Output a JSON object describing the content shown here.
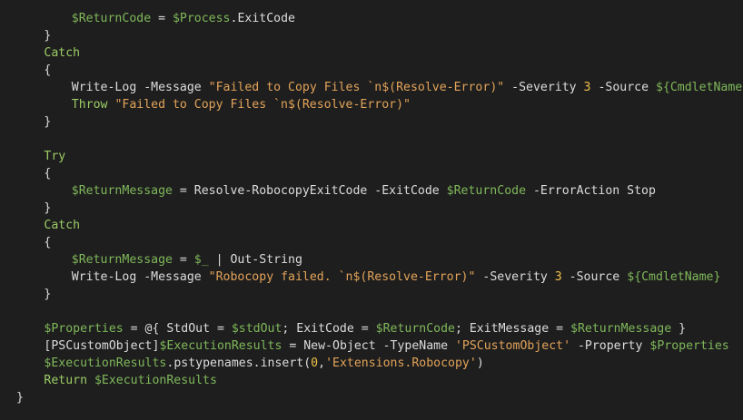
{
  "colors": {
    "background": "#1e1e1e",
    "plain": "#dcdcdc",
    "variable": "#7fb85a",
    "keyword": "#9ccc65",
    "string": "#e2a35a",
    "number": "#f0c04a"
  },
  "lines": [
    {
      "indent": 8,
      "tokens": [
        {
          "c": "var",
          "t": "$ReturnCode"
        },
        {
          "c": "plain",
          "t": " = "
        },
        {
          "c": "var",
          "t": "$Process"
        },
        {
          "c": "plain",
          "t": ".ExitCode"
        }
      ]
    },
    {
      "indent": 4,
      "tokens": [
        {
          "c": "plain",
          "t": "}"
        }
      ]
    },
    {
      "indent": 4,
      "tokens": [
        {
          "c": "kw",
          "t": "Catch"
        }
      ]
    },
    {
      "indent": 4,
      "tokens": [
        {
          "c": "plain",
          "t": "{"
        }
      ]
    },
    {
      "indent": 8,
      "tokens": [
        {
          "c": "plain",
          "t": "Write-Log "
        },
        {
          "c": "param",
          "t": "-Message "
        },
        {
          "c": "str",
          "t": "\"Failed to Copy Files `n$(Resolve-Error)\""
        },
        {
          "c": "param",
          "t": " -Severity "
        },
        {
          "c": "num",
          "t": "3"
        },
        {
          "c": "param",
          "t": " -Source "
        },
        {
          "c": "var",
          "t": "${CmdletName}"
        }
      ]
    },
    {
      "indent": 8,
      "tokens": [
        {
          "c": "kw",
          "t": "Throw "
        },
        {
          "c": "str",
          "t": "\"Failed to Copy Files `n$(Resolve-Error)\""
        }
      ]
    },
    {
      "indent": 4,
      "tokens": [
        {
          "c": "plain",
          "t": "}"
        }
      ]
    },
    {
      "indent": 0,
      "tokens": []
    },
    {
      "indent": 4,
      "tokens": [
        {
          "c": "kw",
          "t": "Try"
        }
      ]
    },
    {
      "indent": 4,
      "tokens": [
        {
          "c": "plain",
          "t": "{"
        }
      ]
    },
    {
      "indent": 8,
      "tokens": [
        {
          "c": "var",
          "t": "$ReturnMessage"
        },
        {
          "c": "plain",
          "t": " = Resolve-RobocopyExitCode "
        },
        {
          "c": "param",
          "t": "-ExitCode "
        },
        {
          "c": "var",
          "t": "$ReturnCode"
        },
        {
          "c": "param",
          "t": " -ErrorAction Stop"
        }
      ]
    },
    {
      "indent": 4,
      "tokens": [
        {
          "c": "plain",
          "t": "}"
        }
      ]
    },
    {
      "indent": 4,
      "tokens": [
        {
          "c": "kw",
          "t": "Catch"
        }
      ]
    },
    {
      "indent": 4,
      "tokens": [
        {
          "c": "plain",
          "t": "{"
        }
      ]
    },
    {
      "indent": 8,
      "tokens": [
        {
          "c": "var",
          "t": "$ReturnMessage"
        },
        {
          "c": "plain",
          "t": " = "
        },
        {
          "c": "var",
          "t": "$_"
        },
        {
          "c": "plain",
          "t": " | Out-String"
        }
      ]
    },
    {
      "indent": 8,
      "tokens": [
        {
          "c": "plain",
          "t": "Write-Log "
        },
        {
          "c": "param",
          "t": "-Message "
        },
        {
          "c": "str",
          "t": "\"Robocopy failed. `n$(Resolve-Error)\""
        },
        {
          "c": "param",
          "t": " -Severity "
        },
        {
          "c": "num",
          "t": "3"
        },
        {
          "c": "param",
          "t": " -Source "
        },
        {
          "c": "var",
          "t": "${CmdletName}"
        }
      ]
    },
    {
      "indent": 4,
      "tokens": [
        {
          "c": "plain",
          "t": "}"
        }
      ]
    },
    {
      "indent": 0,
      "tokens": []
    },
    {
      "indent": 4,
      "tokens": [
        {
          "c": "var",
          "t": "$Properties"
        },
        {
          "c": "plain",
          "t": " = @{ StdOut = "
        },
        {
          "c": "var",
          "t": "$stdOut"
        },
        {
          "c": "plain",
          "t": "; ExitCode = "
        },
        {
          "c": "var",
          "t": "$ReturnCode"
        },
        {
          "c": "plain",
          "t": "; ExitMessage = "
        },
        {
          "c": "var",
          "t": "$ReturnMessage"
        },
        {
          "c": "plain",
          "t": " }"
        }
      ]
    },
    {
      "indent": 4,
      "tokens": [
        {
          "c": "type",
          "t": "[PSCustomObject]"
        },
        {
          "c": "var",
          "t": "$ExecutionResults"
        },
        {
          "c": "plain",
          "t": " = New-Object "
        },
        {
          "c": "param",
          "t": "-TypeName "
        },
        {
          "c": "str",
          "t": "'PSCustomObject'"
        },
        {
          "c": "param",
          "t": " -Property "
        },
        {
          "c": "var",
          "t": "$Properties"
        }
      ]
    },
    {
      "indent": 4,
      "tokens": [
        {
          "c": "var",
          "t": "$ExecutionResults"
        },
        {
          "c": "plain",
          "t": ".pstypenames.insert("
        },
        {
          "c": "num",
          "t": "0"
        },
        {
          "c": "plain",
          "t": ","
        },
        {
          "c": "str",
          "t": "'Extensions.Robocopy'"
        },
        {
          "c": "plain",
          "t": ")"
        }
      ]
    },
    {
      "indent": 4,
      "tokens": [
        {
          "c": "kw",
          "t": "Return "
        },
        {
          "c": "var",
          "t": "$ExecutionResults"
        }
      ]
    },
    {
      "indent": 0,
      "tokens": [
        {
          "c": "plain",
          "t": "}"
        }
      ]
    }
  ]
}
